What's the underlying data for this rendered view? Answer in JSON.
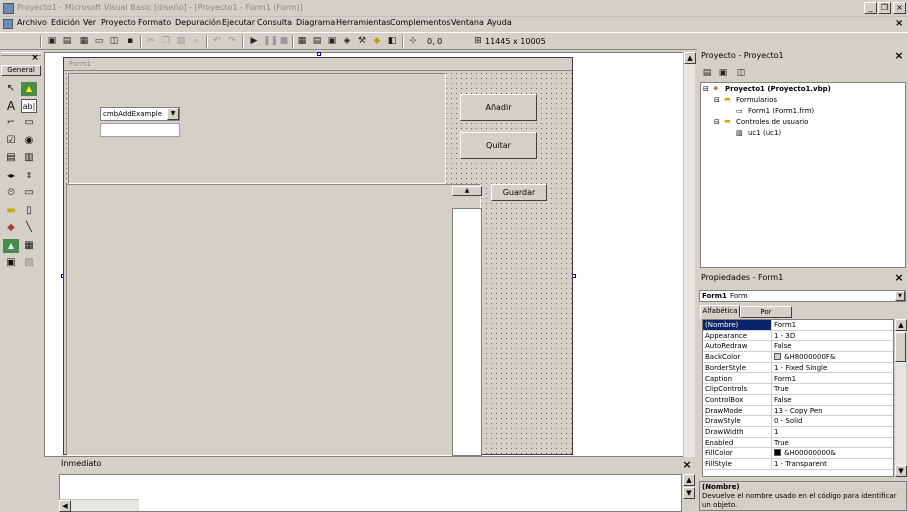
{
  "titlebar": {
    "title": "Proyecto1 - Microsoft Visual Basic [diseño] - [Proyecto1 - Form1 (Form)]",
    "min": "_",
    "restore": "❐",
    "close": "×"
  },
  "menu": [
    "Archivo",
    "Edición",
    "Ver",
    "Proyecto",
    "Formato",
    "Depuración",
    "Ejecutar",
    "Consulta",
    "Diagrama",
    "Herramientas",
    "Complementos",
    "Ventana",
    "Ayuda"
  ],
  "menu_close": "×",
  "toolbar": {
    "position": "0, 0",
    "size": "11445 x 10005"
  },
  "toolbox": {
    "title": "General",
    "tools": [
      "pointer-icon",
      "picture-icon",
      "label-icon",
      "textbox-icon",
      "frame-icon",
      "commandbutton-icon",
      "checkbox-icon",
      "optionbutton-icon",
      "combobox-icon",
      "listbox-icon",
      "hscrollbar-icon",
      "vscrollbar-icon",
      "timer-icon",
      "drivelistbox-icon",
      "dirlistbox-icon",
      "filelistbox-icon",
      "shape-icon",
      "line-icon",
      "image-icon",
      "data-icon",
      "ole-icon",
      "usercontrol-icon"
    ]
  },
  "form": {
    "caption": "Form1",
    "combo_text": "cmbAddExample",
    "btn_add": "Añadir",
    "btn_remove": "Quitar",
    "btn_save": "Guardar"
  },
  "project": {
    "title": "Proyecto - Proyecto1",
    "root": "Proyecto1 (Proyecto1.vbp)",
    "folder_forms": "Formularios",
    "form_item": "Form1 (Form1.frm)",
    "folder_uc": "Controles de usuario",
    "uc_item": "uc1 (uc1)"
  },
  "properties": {
    "title": "Propiedades - Form1",
    "object_name": "Form1",
    "object_type": "Form",
    "tab_alpha": "Alfabética",
    "tab_cat": "Por categorías",
    "rows": [
      {
        "name": "(Nombre)",
        "value": "Form1"
      },
      {
        "name": "Appearance",
        "value": "1 - 3D"
      },
      {
        "name": "AutoRedraw",
        "value": "False"
      },
      {
        "name": "BackColor",
        "value": "&H8000000F&",
        "swatch": "#d4d0c8"
      },
      {
        "name": "BorderStyle",
        "value": "1 - Fixed Single"
      },
      {
        "name": "Caption",
        "value": "Form1"
      },
      {
        "name": "ClipControls",
        "value": "True"
      },
      {
        "name": "ControlBox",
        "value": "False"
      },
      {
        "name": "DrawMode",
        "value": "13 - Copy Pen"
      },
      {
        "name": "DrawStyle",
        "value": "0 - Solid"
      },
      {
        "name": "DrawWidth",
        "value": "1"
      },
      {
        "name": "Enabled",
        "value": "True"
      },
      {
        "name": "FillColor",
        "value": "&H00000000&",
        "swatch": "#000000"
      },
      {
        "name": "FillStyle",
        "value": "1 - Transparent"
      }
    ],
    "desc_title": "(Nombre)",
    "desc_text": "Devuelve el nombre usado en el código para identificar un objeto."
  },
  "immediate": {
    "title": "Inmediato"
  },
  "colors": {
    "face": "#d4d0c8",
    "selection": "#0a246a"
  }
}
